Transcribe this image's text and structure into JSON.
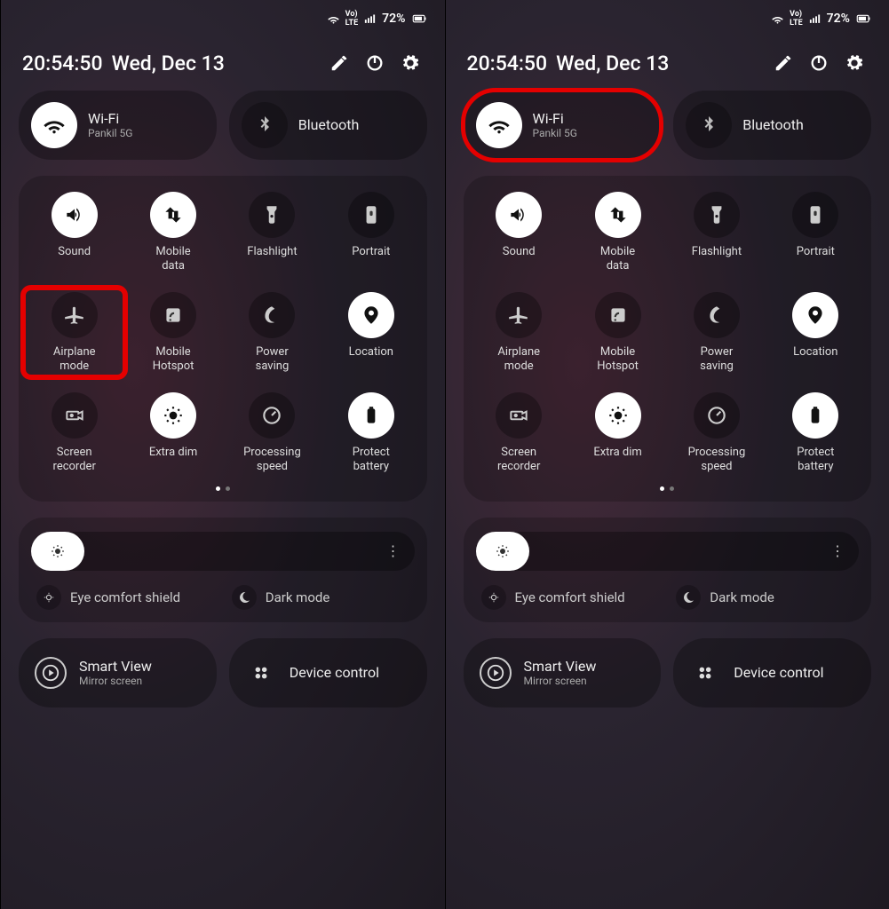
{
  "status": {
    "battery": "72%"
  },
  "header": {
    "time": "20:54:50",
    "date": "Wed, Dec 13"
  },
  "pills": {
    "wifi": {
      "title": "Wi-Fi",
      "subtitle": "Pankil 5G"
    },
    "bluetooth": {
      "title": "Bluetooth"
    }
  },
  "tiles": [
    {
      "id": "sound",
      "label": "Sound",
      "on": true,
      "icon": "volume"
    },
    {
      "id": "mobile-data",
      "label": "Mobile\ndata",
      "on": true,
      "icon": "swap"
    },
    {
      "id": "flashlight",
      "label": "Flashlight",
      "on": false,
      "icon": "flashlight"
    },
    {
      "id": "portrait",
      "label": "Portrait",
      "on": false,
      "icon": "portrait"
    },
    {
      "id": "airplane-mode",
      "label": "Airplane\nmode",
      "on": false,
      "icon": "airplane"
    },
    {
      "id": "mobile-hotspot",
      "label": "Mobile\nHotspot",
      "on": false,
      "icon": "hotspot"
    },
    {
      "id": "power-saving",
      "label": "Power\nsaving",
      "on": false,
      "icon": "leaf"
    },
    {
      "id": "location",
      "label": "Location",
      "on": true,
      "icon": "location"
    },
    {
      "id": "screen-recorder",
      "label": "Screen\nrecorder",
      "on": false,
      "icon": "record"
    },
    {
      "id": "extra-dim",
      "label": "Extra dim",
      "on": true,
      "icon": "dim"
    },
    {
      "id": "processing-speed",
      "label": "Processing\nspeed",
      "on": false,
      "icon": "gauge"
    },
    {
      "id": "protect-battery",
      "label": "Protect\nbattery",
      "on": true,
      "icon": "shieldbat"
    }
  ],
  "brightness": {
    "percent": 14
  },
  "mini": {
    "eye": {
      "label": "Eye comfort shield"
    },
    "dark": {
      "label": "Dark mode"
    }
  },
  "bottom": {
    "smartview": {
      "title": "Smart View",
      "subtitle": "Mirror screen"
    },
    "devicecontrol": {
      "title": "Device control"
    }
  },
  "panels": [
    {
      "highlight_tile": "airplane-mode",
      "highlight_wifi": false
    },
    {
      "highlight_tile": null,
      "highlight_wifi": true
    }
  ]
}
